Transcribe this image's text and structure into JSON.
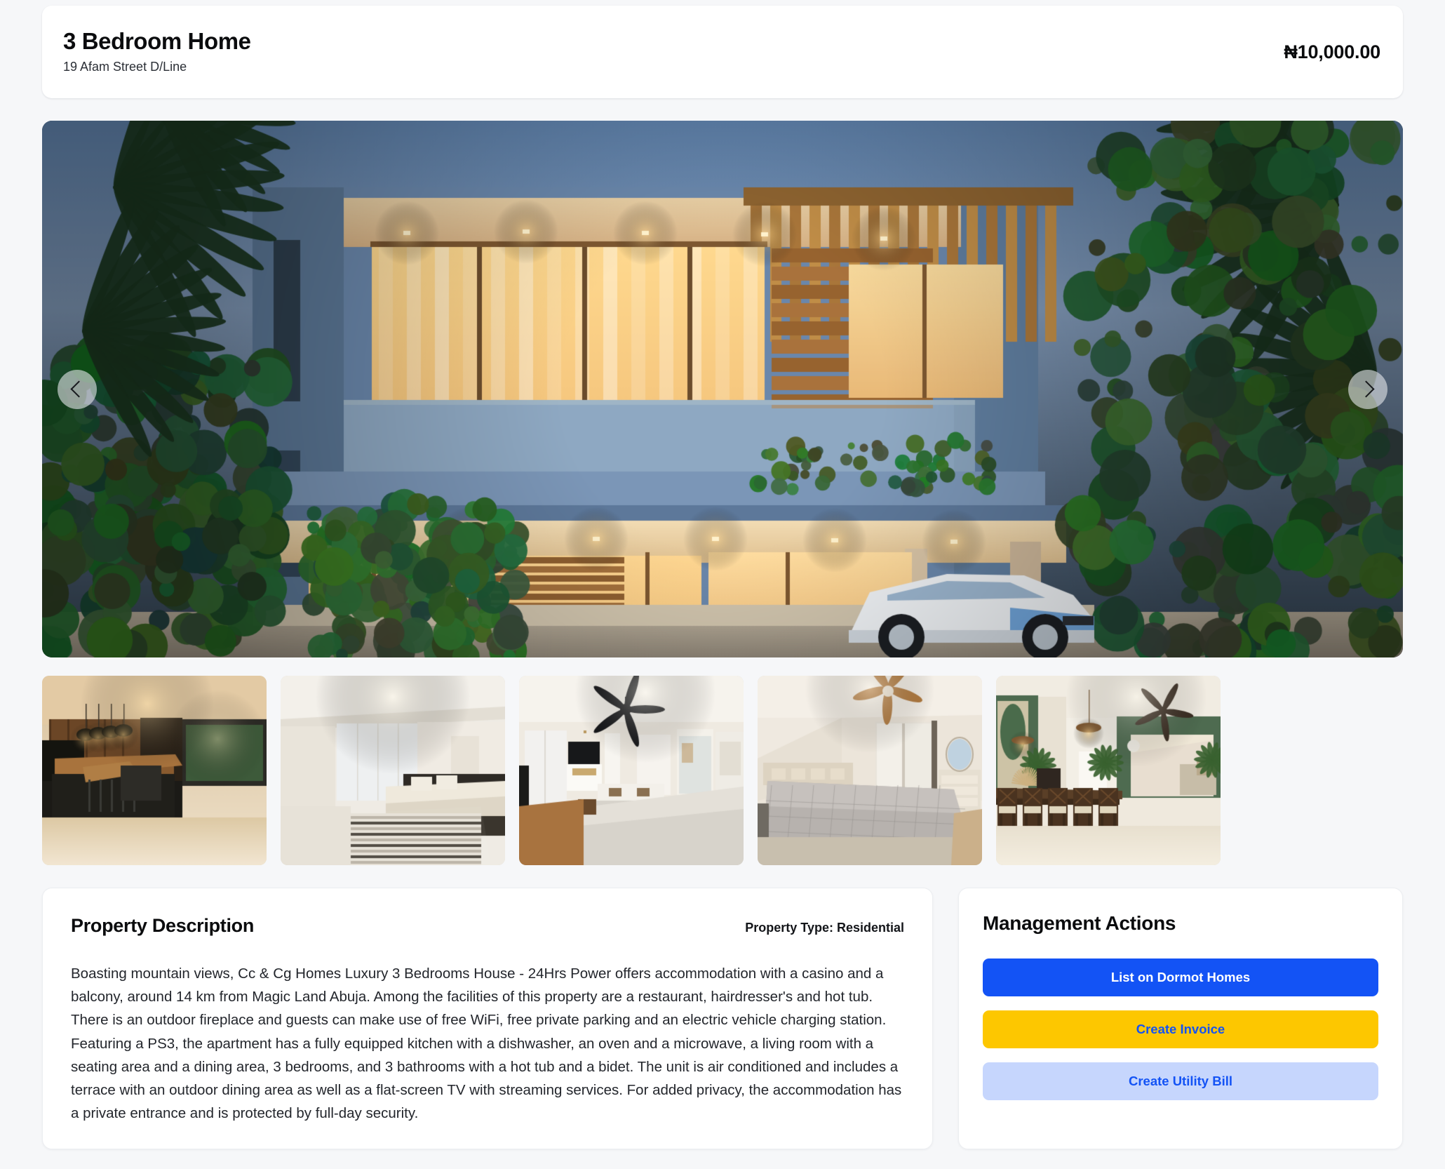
{
  "header": {
    "title": "3 Bedroom Home",
    "address": "19 Afam Street D/Line",
    "price": "₦10,000.00"
  },
  "gallery": {
    "prev_label": "‹",
    "next_label": "›",
    "hero": {
      "alt": "Modern two-storey villa at dusk with wood slat ceiling, glass balcony and white sports car in carport"
    },
    "thumbnails": [
      {
        "alt": "Dark wood kitchen with island, pendant lamps and dining table"
      },
      {
        "alt": "Bedroom with white wardrobe wall and striped rug"
      },
      {
        "alt": "Bedroom with black ceiling fan, TV unit and grey bed"
      },
      {
        "alt": "Bedroom with wooden ceiling fan, wardrobe and dresser mirror"
      },
      {
        "alt": "Dining area with green walls, wooden table and open living room"
      }
    ]
  },
  "description": {
    "title": "Property Description",
    "property_type_label": "Property Type: Residential",
    "body": "Boasting mountain views, Cc & Cg Homes Luxury 3 Bedrooms House - 24Hrs Power offers accommodation with a casino and a balcony, around 14 km from Magic Land Abuja. Among the facilities of this property are a restaurant, hairdresser's and hot tub. There is an outdoor fireplace and guests can make use of free WiFi, free private parking and an electric vehicle charging station. Featuring a PS3, the apartment has a fully equipped kitchen with a dishwasher, an oven and a microwave, a living room with a seating area and a dining area, 3 bedrooms, and 3 bathrooms with a hot tub and a bidet. The unit is air conditioned and includes a terrace with an outdoor dining area as well as a flat-screen TV with streaming services. For added privacy, the accommodation has a private entrance and is protected by full-day security."
  },
  "management_actions": {
    "title": "Management Actions",
    "buttons": [
      {
        "label": "List on Dormot Homes",
        "style": "primary"
      },
      {
        "label": "Create Invoice",
        "style": "warning"
      },
      {
        "label": "Create Utility Bill",
        "style": "soft"
      }
    ]
  },
  "colors": {
    "page_background": "#f6f7f9",
    "card_background": "#ffffff",
    "primary_blue": "#1353f5",
    "warning_yellow": "#fdc700",
    "soft_blue": "#c6d6fd",
    "text_primary": "#0b0c0e"
  }
}
